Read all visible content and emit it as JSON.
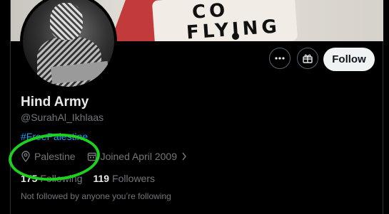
{
  "banner": {
    "line1": "CO",
    "line2": "FLYING"
  },
  "profile": {
    "name": "Hind Army",
    "handle": "@SurahAl_Ikhlaas",
    "bio_hashtag": "#FreePalestine",
    "location": "Palestine",
    "joined": "Joined April 2009",
    "following_count": "175",
    "following_label": "Following",
    "followers_count": "119",
    "followers_label": "Followers",
    "not_followed_text": "Not followed by anyone you’re following"
  },
  "actions": {
    "more_icon": "more-horizontal-icon",
    "gift_icon": "gift-icon",
    "follow_label": "Follow"
  },
  "icons": {
    "location": "location-pin-icon",
    "calendar": "calendar-icon",
    "chevron": "chevron-right-icon"
  },
  "colors": {
    "accent_blue": "#1d9bf0",
    "annotation_green": "#1fd11f",
    "follow_button_bg": "#eff3f4",
    "muted_text": "#71767b"
  }
}
